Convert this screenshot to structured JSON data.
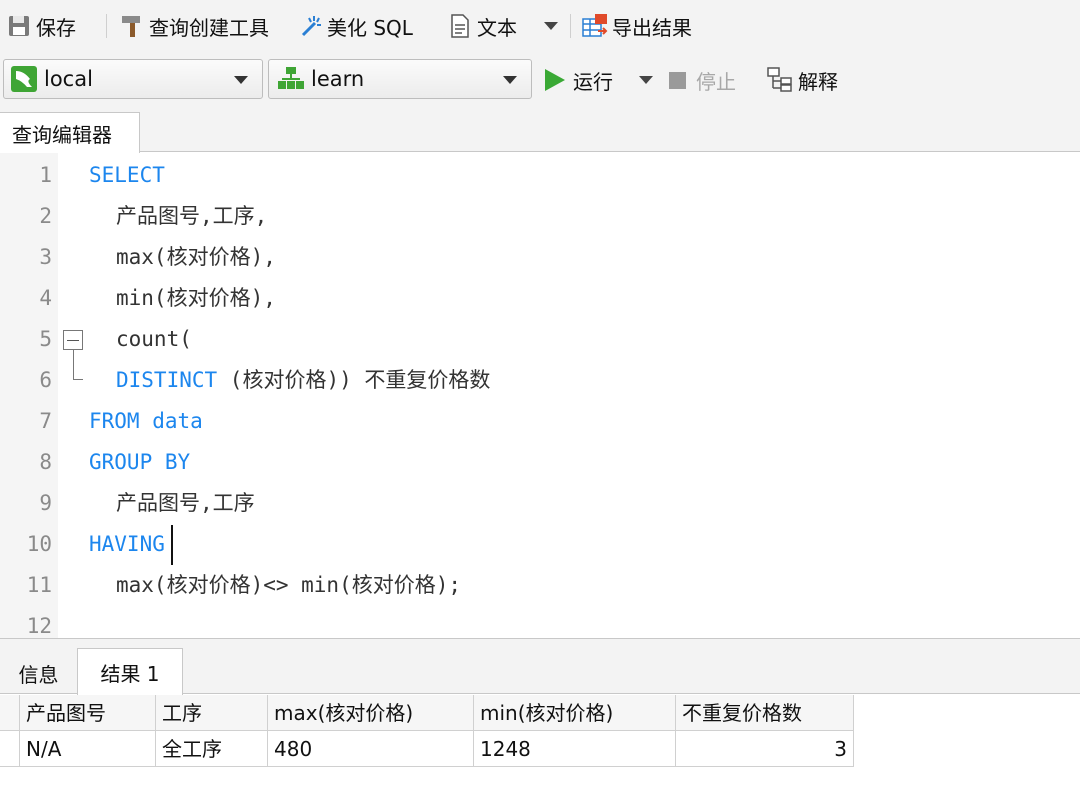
{
  "toolbar": {
    "save": "保存",
    "query_builder": "查询创建工具",
    "beautify": "美化 SQL",
    "text": "文本",
    "export": "导出结果"
  },
  "connection": {
    "server": "local",
    "database": "learn",
    "run": "运行",
    "stop": "停止",
    "explain": "解释"
  },
  "editor_tab": "查询编辑器",
  "code": [
    {
      "ln": "1",
      "kw": "SELECT",
      "rest": "",
      "indent": 0
    },
    {
      "ln": "2",
      "kw": "",
      "rest": "产品图号,工序,",
      "indent": 1
    },
    {
      "ln": "3",
      "kw": "",
      "rest": "max(核对价格),",
      "indent": 1
    },
    {
      "ln": "4",
      "kw": "",
      "rest": "min(核对价格),",
      "indent": 1
    },
    {
      "ln": "5",
      "kw": "",
      "rest": "count(",
      "indent": 1
    },
    {
      "ln": "6",
      "kw": "DISTINCT",
      "rest": " (核对价格)) 不重复价格数",
      "indent": 1
    },
    {
      "ln": "7",
      "kw": "FROM data",
      "rest": "",
      "indent": 0
    },
    {
      "ln": "8",
      "kw": "GROUP BY",
      "rest": "",
      "indent": 0
    },
    {
      "ln": "9",
      "kw": "",
      "rest": "产品图号,工序",
      "indent": 1
    },
    {
      "ln": "10",
      "kw": "HAVING",
      "rest": "",
      "indent": 0
    },
    {
      "ln": "11",
      "kw": "",
      "rest": "max(核对价格)<> min(核对价格);",
      "indent": 1
    },
    {
      "ln": "12",
      "kw": "",
      "rest": "",
      "indent": 0
    }
  ],
  "result_tabs": {
    "info": "信息",
    "result": "结果 1"
  },
  "grid": {
    "columns": [
      "产品图号",
      "工序",
      "max(核对价格)",
      "min(核对价格)",
      "不重复价格数"
    ],
    "rows": [
      [
        "N/A",
        "全工序",
        "480",
        "1248",
        "3"
      ]
    ]
  }
}
